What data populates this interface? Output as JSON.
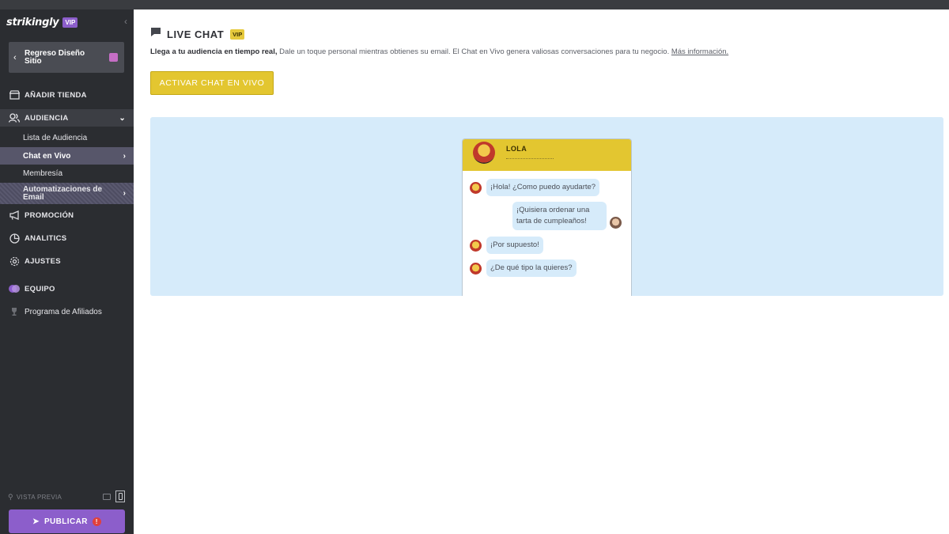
{
  "sidebar": {
    "logo": "strikingly",
    "vip": "VIP",
    "back_label": "Regreso Diseño Sitio",
    "nav": {
      "add_store": "AÑADIR TIENDA",
      "audience": "AUDIENCIA",
      "promotion": "PROMOCIÓN",
      "analytics": "ANALITICS",
      "settings": "AJUSTES",
      "team": "EQUIPO",
      "affiliates": "Programa de Afiliados"
    },
    "audience_sub": {
      "list": "Lista de Audiencia",
      "live_chat": "Chat en Vivo",
      "membership": "Membresía",
      "email_auto": "Automatizaciones de Email"
    },
    "preview_label": "VISTA PREVIA",
    "publish_label": "PUBLICAR",
    "publish_warning": "!"
  },
  "main": {
    "title": "LIVE CHAT",
    "title_badge": "VIP",
    "desc_bold": "Llega a tu audiencia en tiempo real,",
    "desc_text": " Dale un toque personal mientras obtienes su email. El Chat en Vivo genera valiosas conversaciones para tu negocio. ",
    "desc_link": "Más información.",
    "activate_label": "ACTIVAR CHAT EN VIVO"
  },
  "chat_preview": {
    "agent_name": "LOLA",
    "messages": [
      {
        "from": "agent",
        "text": "¡Hola! ¿Como puedo ayudarte?"
      },
      {
        "from": "user",
        "text": "¡Quisiera ordenar una tarta de cumpleaños!"
      },
      {
        "from": "agent",
        "text": "¡Por supuesto!"
      },
      {
        "from": "agent",
        "text": "¿De qué tipo la quieres?"
      }
    ]
  },
  "colors": {
    "sidebar_bg": "#2b2d31",
    "accent_purple": "#8c5ecb",
    "accent_yellow": "#e3c630",
    "preview_bg": "#d6ebfa"
  }
}
